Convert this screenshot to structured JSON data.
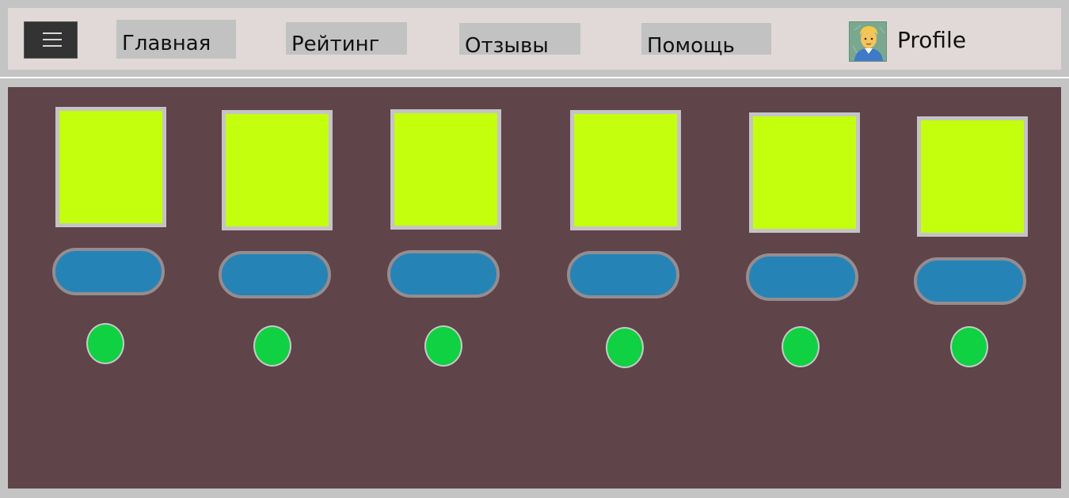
{
  "header": {
    "menu_icon": "hamburger-icon",
    "nav": [
      {
        "label": "Главная"
      },
      {
        "label": "Рейтинг"
      },
      {
        "label": "Отзывы"
      },
      {
        "label": "Помощь"
      }
    ],
    "profile": {
      "avatar_icon": "man-emoji-avatar-icon",
      "label": "Profile"
    }
  },
  "colors": {
    "header_bg": "#e0d9d7",
    "nav_bg": "#c2c2c2",
    "menu_button_bg": "#333333",
    "main_bg": "#5f444a",
    "card_fill": "#c4ff0e",
    "card_border": "#c5c3c6",
    "pill_fill": "#2683b6",
    "pill_border": "#958c8f",
    "dot_fill": "#10d141"
  },
  "main": {
    "columns": [
      {
        "card": "image-placeholder",
        "button": "pill-button",
        "indicator": "green-dot"
      },
      {
        "card": "image-placeholder",
        "button": "pill-button",
        "indicator": "green-dot"
      },
      {
        "card": "image-placeholder",
        "button": "pill-button",
        "indicator": "green-dot"
      },
      {
        "card": "image-placeholder",
        "button": "pill-button",
        "indicator": "green-dot"
      },
      {
        "card": "image-placeholder",
        "button": "pill-button",
        "indicator": "green-dot"
      },
      {
        "card": "image-placeholder",
        "button": "pill-button",
        "indicator": "green-dot"
      }
    ]
  }
}
